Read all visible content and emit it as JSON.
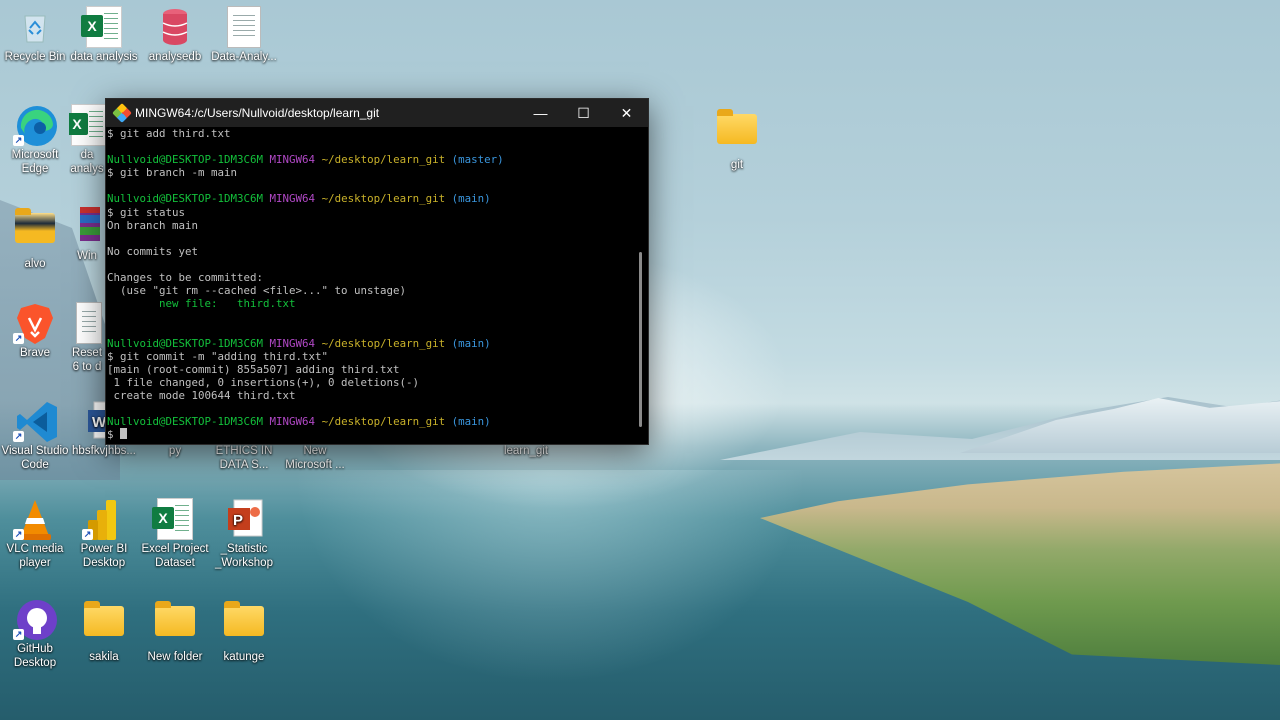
{
  "desktop": {
    "icons": [
      {
        "label": "Recycle Bin",
        "icon": "recycle-bin-icon"
      },
      {
        "label": "data analysis",
        "icon": "excel-icon"
      },
      {
        "label": "analysedb",
        "icon": "database-icon"
      },
      {
        "label": "Data-Analy...",
        "icon": "document-icon"
      },
      {
        "label": "Microsoft Edge",
        "icon": "edge-icon"
      },
      {
        "label": "da analys",
        "icon": "excel-icon"
      },
      {
        "label": "alvo",
        "icon": "folder-icon"
      },
      {
        "label": "Win",
        "icon": "winrar-icon"
      },
      {
        "label": "Brave",
        "icon": "brave-icon"
      },
      {
        "label": "Reset 6 to d",
        "icon": "document-icon"
      },
      {
        "label": "Visual Studio Code",
        "icon": "vscode-icon"
      },
      {
        "label": "hbsfkvjhbs...",
        "icon": "word-icon"
      },
      {
        "label": "py",
        "icon": "folder-icon"
      },
      {
        "label": "ETHICS IN DATA S...",
        "icon": "document-icon"
      },
      {
        "label": "New Microsoft ...",
        "icon": "document-icon"
      },
      {
        "label": "learn_git",
        "icon": "folder-icon"
      },
      {
        "label": "VLC media player",
        "icon": "vlc-icon"
      },
      {
        "label": "Power BI Desktop",
        "icon": "powerbi-icon"
      },
      {
        "label": "Excel Project Dataset",
        "icon": "excel-icon"
      },
      {
        "label": "_Statistic _Workshop",
        "icon": "powerpoint-icon"
      },
      {
        "label": "GitHub Desktop",
        "icon": "github-icon"
      },
      {
        "label": "sakila",
        "icon": "folder-icon"
      },
      {
        "label": "New folder",
        "icon": "folder-icon"
      },
      {
        "label": "katunge",
        "icon": "folder-icon"
      },
      {
        "label": "git",
        "icon": "folder-icon"
      }
    ]
  },
  "terminal": {
    "title": "MINGW64:/c/Users/Nullvoid/desktop/learn_git",
    "minimize": "—",
    "maximize": "☐",
    "close": "✕",
    "user_host": "Nullvoid@DESKTOP-1DM3C6M",
    "shell": "MINGW64",
    "path": "~/desktop/learn_git",
    "lines": {
      "l1": "$ git add third.txt",
      "p1_branch": "(master)",
      "l3": "$ git branch -m main",
      "p2_branch": "(main)",
      "l5": "$ git status",
      "l6": "On branch main",
      "l8": "No commits yet",
      "l10": "Changes to be committed:",
      "l11": "  (use \"git rm --cached <file>...\" to unstage)",
      "l12": "        new file:   third.txt",
      "p3_branch": "(main)",
      "l16": "$ git commit -m \"adding third.txt\"",
      "l17": "[main (root-commit) 855a507] adding third.txt",
      "l18": " 1 file changed, 0 insertions(+), 0 deletions(-)",
      "l19": " create mode 100644 third.txt",
      "p4_branch": "(main)",
      "l22": "$ "
    }
  }
}
